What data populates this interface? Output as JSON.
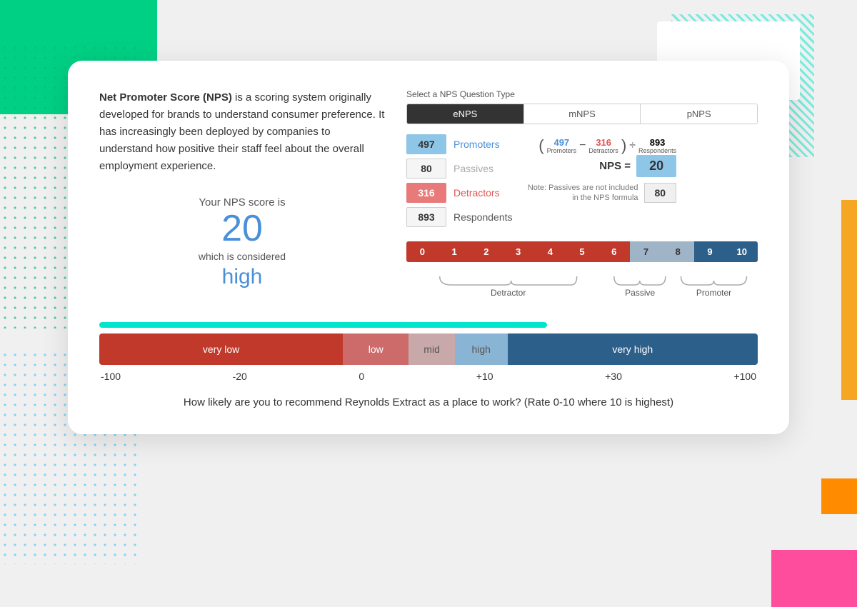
{
  "background": {
    "accent_green": "#00d084",
    "accent_cyan": "#00e5cc",
    "accent_orange": "#f5a623",
    "accent_pink": "#ff4d9e"
  },
  "card": {
    "description_bold": "Net Promoter Score (NPS)",
    "description_text": " is a scoring system originally developed for brands to understand consumer preference.  It has increasingly been deployed by companies to understand how positive their staff feel about the overall employment experience.",
    "nps_score_label": "Your NPS score is",
    "nps_score_value": "20",
    "nps_considered_label": "which is considered",
    "nps_considered_value": "high"
  },
  "question_type": {
    "label": "Select a NPS Question Type",
    "tabs": [
      {
        "id": "eNPS",
        "label": "eNPS",
        "active": true
      },
      {
        "id": "mNPS",
        "label": "mNPS",
        "active": false
      },
      {
        "id": "pNPS",
        "label": "pNPS",
        "active": false
      }
    ]
  },
  "stats": {
    "promoters": {
      "value": "497",
      "label": "Promoters"
    },
    "passives": {
      "value": "80",
      "label": "Passives"
    },
    "detractors": {
      "value": "316",
      "label": "Detractors"
    },
    "respondents": {
      "value": "893",
      "label": "Respondents"
    }
  },
  "formula": {
    "promoters_val": "497",
    "promoters_sub": "Promoters",
    "minus": "−",
    "detractors_val": "316",
    "detractors_sub": "Detractors",
    "divide": "÷",
    "respondents_val": "893",
    "respondents_sub": "Respondents",
    "nps_label": "NPS =",
    "nps_value": "20",
    "passives_note": "Note: Passives are not included in the NPS formula",
    "passives_value": "80"
  },
  "scale": {
    "numbers": [
      "0",
      "1",
      "2",
      "3",
      "4",
      "5",
      "6",
      "7",
      "8",
      "9",
      "10"
    ],
    "detractor_label": "Detractor",
    "passive_label": "Passive",
    "promoter_label": "Promoter"
  },
  "score_bar": {
    "segments": [
      {
        "label": "very low",
        "width": "37%"
      },
      {
        "label": "low",
        "width": "10%"
      },
      {
        "label": "mid",
        "width": "7%"
      },
      {
        "label": "high",
        "width": "8%"
      },
      {
        "label": "very high",
        "width": "38%"
      }
    ],
    "axis": [
      "-100",
      "-20",
      "0",
      "+10",
      "+30",
      "+100"
    ]
  },
  "question": {
    "text": "How likely are you to recommend Reynolds Extract as a place to work? (Rate 0-10 where 10 is highest)"
  }
}
